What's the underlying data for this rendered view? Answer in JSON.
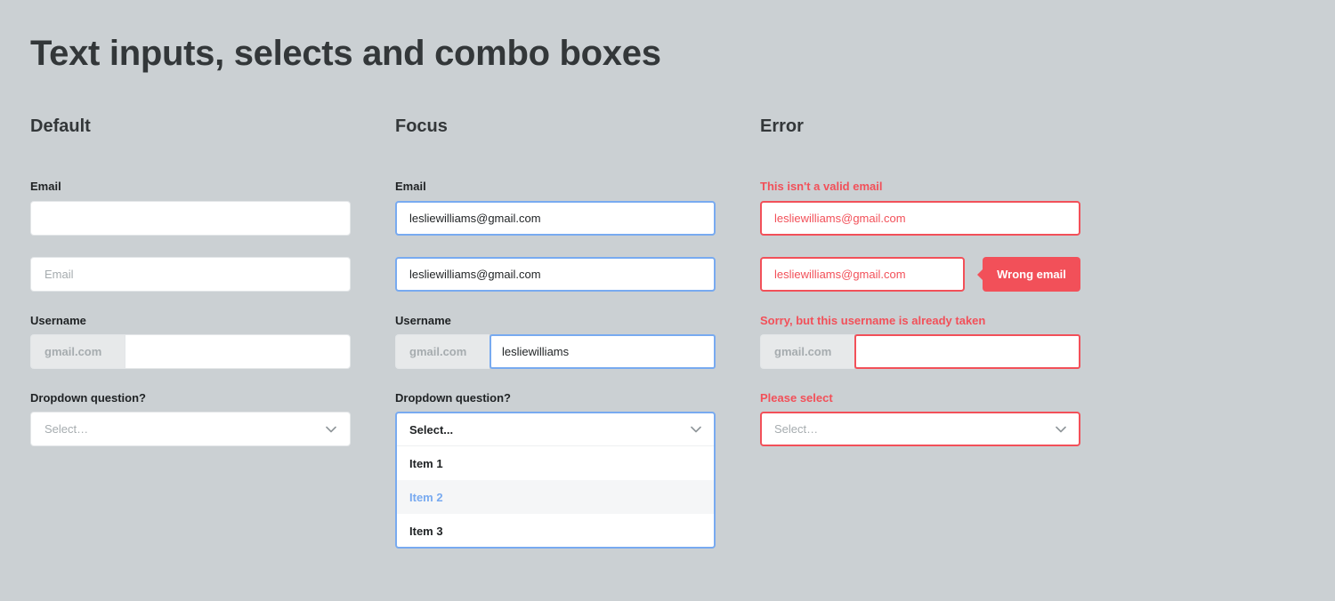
{
  "page_title": "Text inputs, selects and combo boxes",
  "colors": {
    "background": "#cbd0d3",
    "focus": "#78aaf0",
    "error": "#f25059",
    "text": "#1f2224",
    "placeholder": "#a6acaf"
  },
  "default": {
    "heading": "Default",
    "email_label": "Email",
    "email_value": "",
    "email2_placeholder": "Email",
    "username_label": "Username",
    "username_prefix": "gmail.com",
    "username_value": "",
    "dropdown_label": "Dropdown question?",
    "dropdown_placeholder": "Select…",
    "dropdown_icon": "chevron-down-icon"
  },
  "focus": {
    "heading": "Focus",
    "email_label": "Email",
    "email_value": "lesliewilliams@gmail.com",
    "email2_value": "lesliewilliams@gmail.com",
    "username_label": "Username",
    "username_prefix": "gmail.com",
    "username_value": "lesliewilliams",
    "dropdown_label": "Dropdown question?",
    "dropdown_selected": "Select...",
    "dropdown_icon": "chevron-down-icon",
    "dropdown_items": [
      "Item 1",
      "Item 2",
      "Item 3"
    ]
  },
  "error": {
    "heading": "Error",
    "email_error": "This isn't a valid email",
    "email_value": "lesliewilliams@gmail.com",
    "email2_value": "lesliewilliams@gmail.com",
    "tooltip": "Wrong email",
    "username_error": "Sorry, but this username is already taken",
    "username_prefix": "gmail.com",
    "username_value": "",
    "dropdown_error": "Please select",
    "dropdown_placeholder": "Select…",
    "dropdown_icon": "chevron-down-icon"
  }
}
